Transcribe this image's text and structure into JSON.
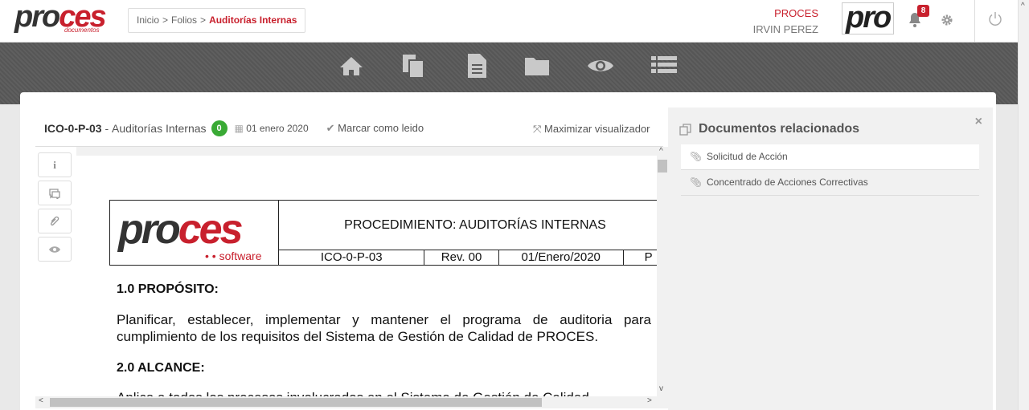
{
  "header": {
    "logo": {
      "part1": "pro",
      "part2": "ces",
      "sub": "documentos"
    },
    "breadcrumb": [
      {
        "label": "Inicio"
      },
      {
        "label": "Folios"
      },
      {
        "label": "Auditorías Internas",
        "current": true
      }
    ],
    "company": "PROCES",
    "user_name": "IRVIN PEREZ",
    "user_logo_text": "pro",
    "notification_count": "8"
  },
  "nav": {
    "icons": [
      "home-icon",
      "documents-icon",
      "file-icon",
      "folder-icon",
      "eye-icon",
      "list-icon"
    ]
  },
  "document": {
    "code": "ICO-0-P-03",
    "separator": " - ",
    "title": "Auditorías Internas",
    "count": "0",
    "date": "01 enero 2020",
    "mark_read": "Marcar como leido",
    "maximize": "Maximizar visualizador"
  },
  "viewer": {
    "logo_part1": "pro",
    "logo_part2": "ces",
    "logo_sub": "• • software",
    "procedure_title": "PROCEDIMIENTO: AUDITORÍAS INTERNAS",
    "cells": [
      "ICO-0-P-03",
      "Rev. 00",
      "01/Enero/2020",
      "P"
    ],
    "section1": "1.0 PROPÓSITO:",
    "paragraph1": "Planificar, establecer, implementar y mantener el programa de auditoria para cumplimiento de los requisitos del Sistema de Gestión de Calidad de PROCES.",
    "section2": "2.0 ALCANCE:",
    "cut_line": "Aplica a todos los procesos involucrados en el Sistema de Gestión de Calidad"
  },
  "related": {
    "title": "Documentos relacionados",
    "items": [
      "Solicitud de Acción",
      "Concentrado de Acciones Correctivas"
    ]
  },
  "colors": {
    "accent": "#c8202d",
    "badge_green": "#3aaa35",
    "navbar": "#5a5a5a"
  }
}
